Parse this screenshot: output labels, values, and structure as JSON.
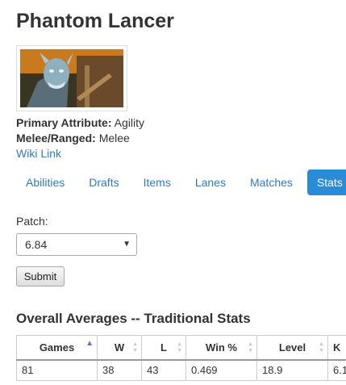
{
  "hero": {
    "name": "Phantom Lancer",
    "portrait_icon": "hero-portrait",
    "primary_attribute_label": "Primary Attribute:",
    "primary_attribute": "Agility",
    "attack_type_label": "Melee/Ranged:",
    "attack_type": "Melee",
    "wiki_link": "Wiki Link"
  },
  "tabs": [
    {
      "label": "Abilities",
      "active": false
    },
    {
      "label": "Drafts",
      "active": false
    },
    {
      "label": "Items",
      "active": false
    },
    {
      "label": "Lanes",
      "active": false
    },
    {
      "label": "Matches",
      "active": false
    },
    {
      "label": "Stats",
      "active": true
    }
  ],
  "patch": {
    "label": "Patch:",
    "selected": "6.84",
    "submit_label": "Submit"
  },
  "overall": {
    "title": "Overall Averages -- Traditional Stats",
    "columns": [
      "Games",
      "W",
      "L",
      "Win %",
      "Level",
      "K"
    ],
    "row": [
      "81",
      "38",
      "43",
      "0.469",
      "18.9",
      "6.1"
    ],
    "sorted_column": "Games",
    "sort_direction": "ascending"
  },
  "colors": {
    "link": "#337ab7",
    "active_tab": "#2a8bd6",
    "sort_indicator": "#6670c4"
  }
}
